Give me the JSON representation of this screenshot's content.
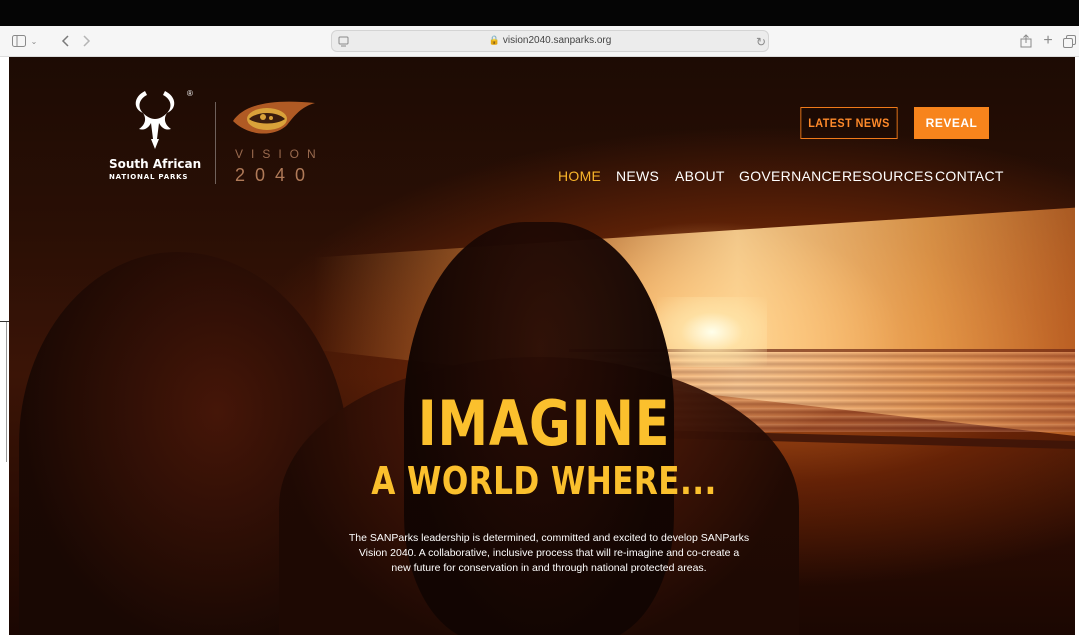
{
  "browser": {
    "url": "vision2040.sanparks.org",
    "toolbar_icons": [
      "sidebar-icon",
      "chevron-down-icon",
      "back-icon",
      "forward-icon",
      "page-menu-icon",
      "lock-icon",
      "reload-icon",
      "share-icon",
      "plus-icon",
      "tabs-icon"
    ]
  },
  "site": {
    "logo": {
      "line1": "South African",
      "line2": "NATIONAL PARKS",
      "registered": "®",
      "vision_word": "VISION",
      "vision_year": "2040"
    },
    "buttons": {
      "latest_news": "LATEST NEWS",
      "reveal": "REVEAL"
    },
    "nav": {
      "home": "HOME",
      "news": "NEWS",
      "about": "ABOUT",
      "governance": "GOVERNANCE",
      "resources": "RESOURCES",
      "contact": "CONTACT"
    },
    "hero": {
      "headline_line1": "IMAGINE",
      "headline_line2": "A WORLD WHERE...",
      "blurb_line1": "The SANParks leadership is determined, committed and excited to develop SANParks",
      "blurb_line2": "Vision 2040. A collaborative, inclusive process that will re-imagine and co-create a",
      "blurb_line3": "new future for conservation in and through national protected areas."
    }
  },
  "colors": {
    "accent": "#f7841c",
    "headline": "#fbc02d",
    "nav_active": "#f9b52a"
  }
}
